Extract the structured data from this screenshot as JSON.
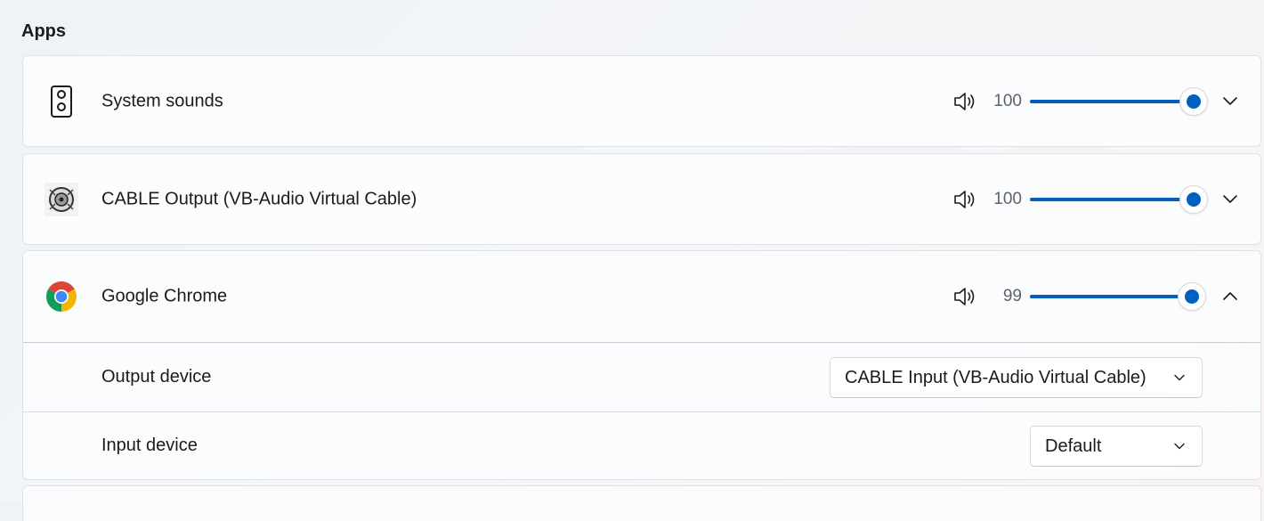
{
  "section": {
    "title": "Apps"
  },
  "apps": [
    {
      "name": "System sounds",
      "icon": "speaker-device-icon",
      "volume": 100,
      "volume_label": "100",
      "expanded": false
    },
    {
      "name": "CABLE Output (VB-Audio Virtual Cable)",
      "icon": "vb-audio-cable-icon",
      "volume": 100,
      "volume_label": "100",
      "expanded": false
    },
    {
      "name": "Google Chrome",
      "icon": "chrome-icon",
      "volume": 99,
      "volume_label": "99",
      "expanded": true
    }
  ],
  "chrome_details": {
    "output_label": "Output device",
    "output_value": "CABLE Input (VB-Audio Virtual Cable)",
    "input_label": "Input device",
    "input_value": "Default"
  },
  "colors": {
    "accent": "#0060c0",
    "chrome_red": "#db4437",
    "chrome_yellow": "#f4b400",
    "chrome_green": "#0f9d58",
    "chrome_blue": "#4285f4"
  }
}
